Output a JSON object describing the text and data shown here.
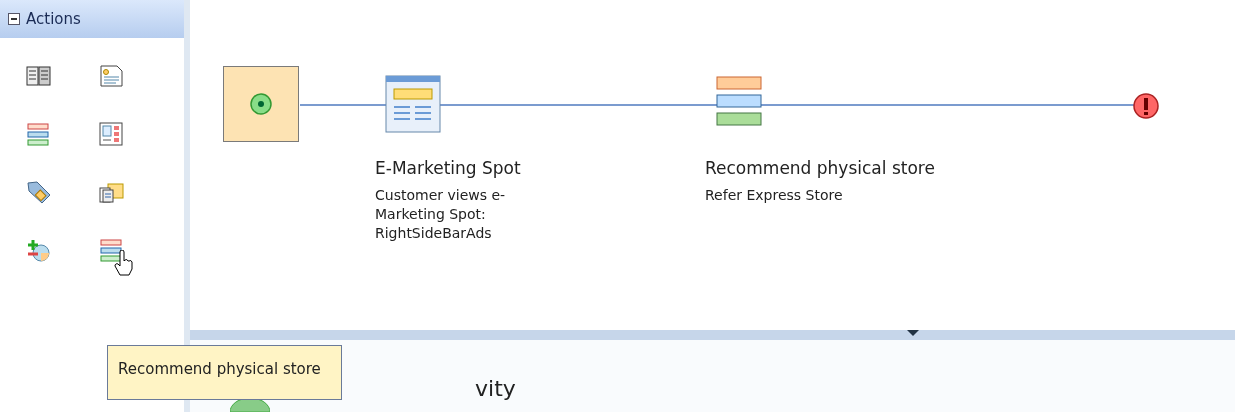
{
  "sidebar": {
    "title": "Actions",
    "expanded": true,
    "actions": [
      {
        "kind": "catalog",
        "hovered": false
      },
      {
        "kind": "document",
        "hovered": false
      },
      {
        "kind": "stack",
        "hovered": false
      },
      {
        "kind": "panel",
        "hovered": false
      },
      {
        "kind": "tag",
        "hovered": false
      },
      {
        "kind": "folders",
        "hovered": false
      },
      {
        "kind": "add-remove",
        "hovered": false
      },
      {
        "kind": "stack",
        "hovered": true
      }
    ]
  },
  "tooltip": {
    "text": "Recommend physical store"
  },
  "flow": {
    "nodes": [
      {
        "kind": "start",
        "selected": true
      },
      {
        "kind": "spot",
        "selected": false,
        "title": "E-Marketing Spot",
        "description": "Customer views e-Marketing Spot: RightSideBarAds"
      },
      {
        "kind": "stack",
        "selected": false,
        "title": "Recommend physical store",
        "description": "Refer Express Store"
      },
      {
        "kind": "end",
        "selected": false
      }
    ]
  },
  "details": {
    "title": "vity"
  }
}
